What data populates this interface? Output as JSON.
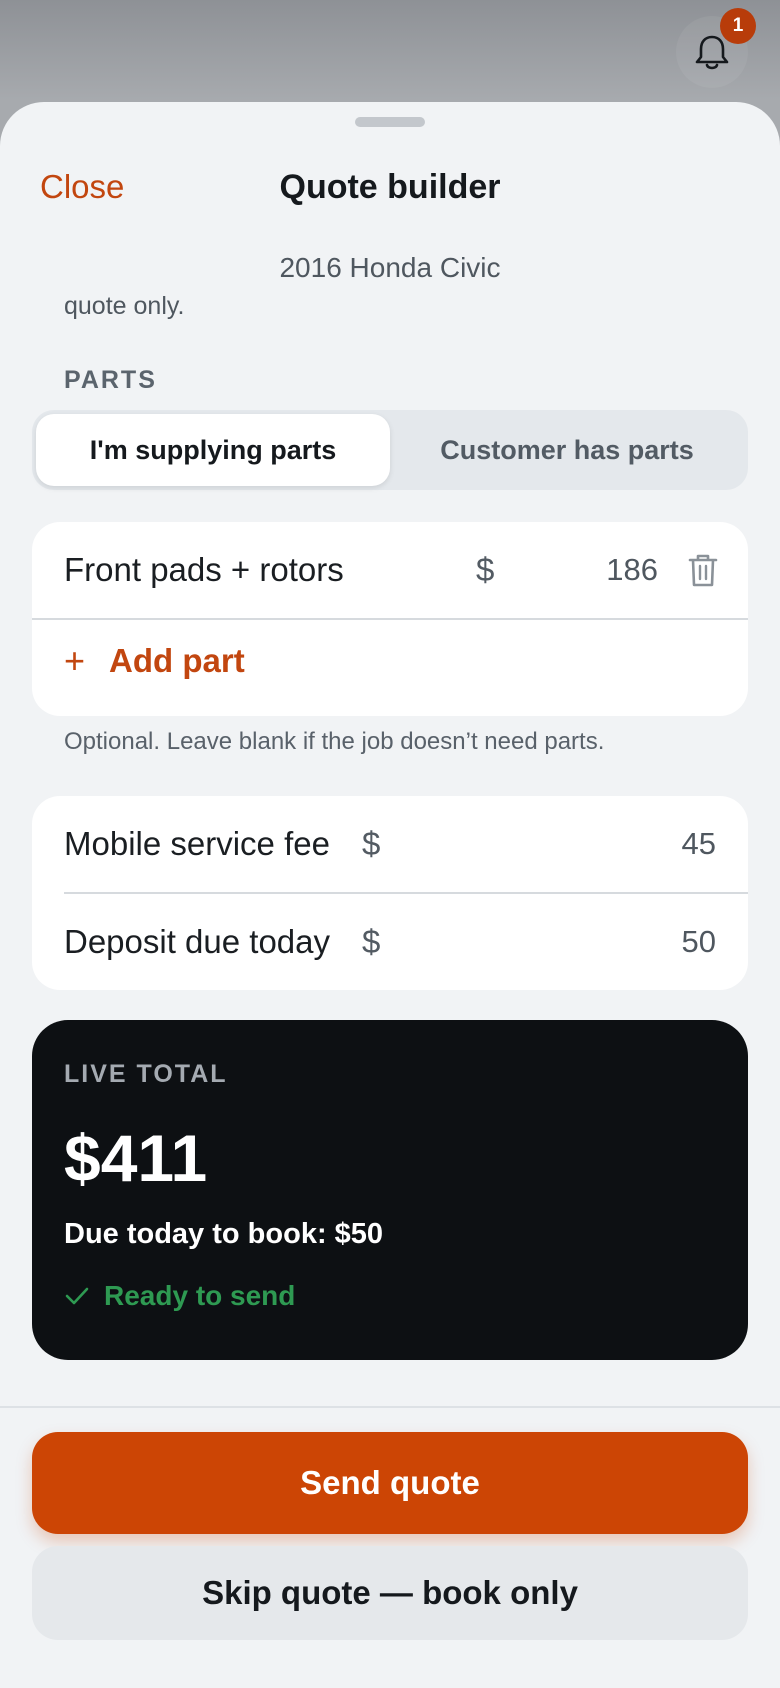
{
  "notifications": {
    "count": "1",
    "icon": "bell-icon"
  },
  "header": {
    "close_label": "Close",
    "title": "Quote builder",
    "subtitle": "2016 Honda Civic",
    "clipped_text": "quote only."
  },
  "parts": {
    "section_label": "PARTS",
    "segments": [
      {
        "label": "I'm supplying parts",
        "selected": true
      },
      {
        "label": "Customer has parts",
        "selected": false
      }
    ],
    "items": [
      {
        "name": "Front pads + rotors",
        "currency": "$",
        "amount": "186",
        "delete_icon": "trash-icon"
      }
    ],
    "add_label": "Add part",
    "add_icon": "plus-icon",
    "helper_text": "Optional. Leave blank if the job doesn’t need parts."
  },
  "fees": [
    {
      "label": "Mobile service fee",
      "currency": "$",
      "amount": "45"
    },
    {
      "label": "Deposit due today",
      "currency": "$",
      "amount": "50"
    }
  ],
  "total": {
    "label": "LIVE TOTAL",
    "amount": "$411",
    "due_today": "Due today to book: $50",
    "status": "Ready to send",
    "status_icon": "check-icon"
  },
  "actions": {
    "primary": "Send quote",
    "secondary": "Skip quote — book only"
  },
  "colors": {
    "accent": "#cc4505",
    "accent_text": "#c2460f",
    "success": "#2e9a52",
    "dark_card": "#0d1013",
    "sheet_bg": "#f1f3f5"
  }
}
